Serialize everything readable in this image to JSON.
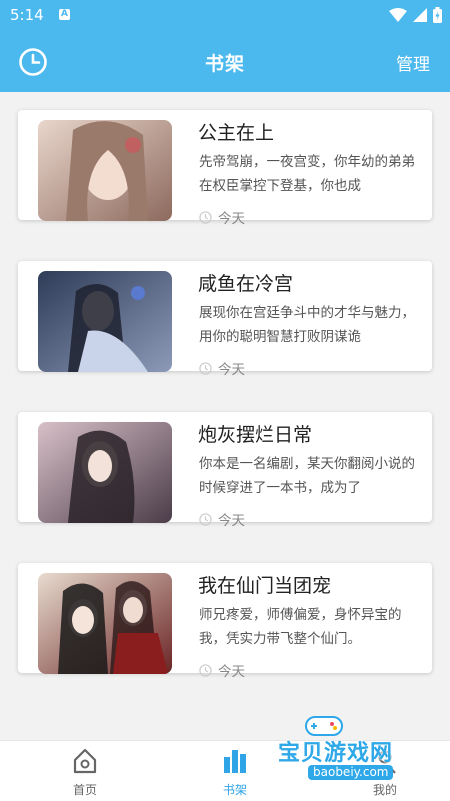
{
  "status": {
    "time": "5:14",
    "notif_letter": "A"
  },
  "header": {
    "title": "书架",
    "manage_label": "管理",
    "history_icon": "clock-icon"
  },
  "books": [
    {
      "title": "公主在上",
      "description": "先帝驾崩，一夜宫变，你年幼的弟弟在权臣掌控下登基，你也成",
      "time": "今天",
      "cover_colors": [
        "#d9b8a8",
        "#7a5a52"
      ]
    },
    {
      "title": "咸鱼在冷宫",
      "description": "展现你在宫廷争斗中的才华与魅力，用你的聪明智慧打败阴谋诡",
      "time": "今天",
      "cover_colors": [
        "#3a4a6a",
        "#c8d0e0"
      ]
    },
    {
      "title": "炮灰摆烂日常",
      "description": "你本是一名编剧，某天你翻阅小说的时候穿进了一本书，成为了",
      "time": "今天",
      "cover_colors": [
        "#b89aa8",
        "#3b3440"
      ]
    },
    {
      "title": "我在仙门当团宠",
      "description": "师兄疼爱，师傅偏爱，身怀异宝的我，凭实力带飞整个仙门。",
      "time": "今天",
      "cover_colors": [
        "#7a2a2a",
        "#e8d8c8"
      ]
    }
  ],
  "nav": {
    "home_label": "首页",
    "shelf_label": "书架",
    "mine_label": "我的",
    "active_color": "#2fa4e7",
    "inactive_color": "#666666"
  },
  "watermark": {
    "main": "宝贝游戏网",
    "sub": "baobeiy.com"
  }
}
